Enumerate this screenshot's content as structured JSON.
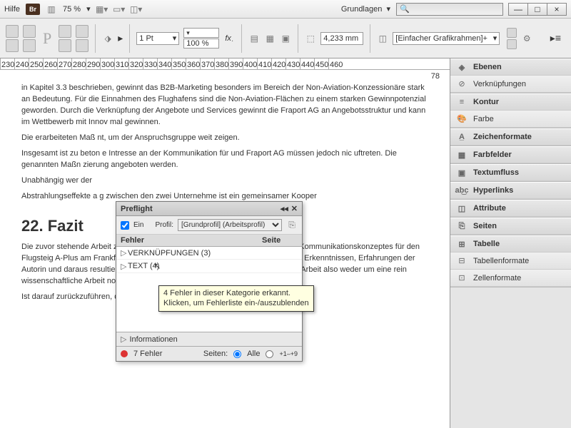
{
  "titlebar": {
    "help": "Hilfe",
    "bridge": "Br",
    "zoom": "75 %",
    "workspace": "Grundlagen",
    "search_placeholder": "🔍"
  },
  "toolbar": {
    "stroke": "1 Pt",
    "pct": "100 %",
    "measure": "4,233 mm",
    "frame": "[Einfacher Grafikrahmen]+"
  },
  "ruler": [
    "230",
    "240",
    "250",
    "260",
    "270",
    "280",
    "290",
    "300",
    "310",
    "320",
    "330",
    "340",
    "350",
    "360",
    "370",
    "380",
    "390",
    "400",
    "410",
    "420",
    "430",
    "440",
    "450",
    "460"
  ],
  "doc": {
    "pagenum": "78",
    "p1": "in Kapitel 3.3 beschrieben, gewinnt das B2B-Marketing besonders im Bereich der Non-Aviation-Konzessionäre stark an Bedeutung. Für die Einnahmen des Flughafens sind die Non-Aviation-Flächen zu einem starken Gewinnpotenzial geworden. Durch die Verknüpfung der Angebote und Services gewinnt die Fraport AG an Angebotsstruktur und kann im Wettbewerb mit Innov                                                                                         mal gewinnen.",
    "p2": "Die erarbeiteten Maß                                                                                       nt, um der Anspruchsgruppe weit                                                                                  zeigen.",
    "p3": "Insgesamt ist zu beton                                                                                     e Intresse an der Kommunikation für                                                                              und Fraport AG müssen jedoch nic                                                                                 uftreten. Die genannten Maßn                                                                                     zierung angeboten werden.",
    "p4": "Unabhängig wer der",
    "p5": "Abstrahlungseffekte a                                                                                      g zwischen den zwei Unternehme                                                                                    ist ein gemeinsamer Kooper",
    "h2": "22. Fazit",
    "p6": "Die zuvor stehende Arbeit zum Thema „Analyse zur Empfehlung eines digitalen Kommunikationskonzeptes für den Flugsteig A-Plus am Frankfurter Flughafen“ wurde aus literaturwissenschaftlicher Erkenntnissen, Erfahrungen der Autorin und daraus resultierenden Ergebnissen verfasst. Es handelt sich bei der Arbeit also weder um eine rein wissenschaftliche Arbeit noch um ein klassisches Kommunikationskonzept.",
    "p7": "Ist darauf zurückzuführen, dass es sich bei einem Flughafen um ein international"
  },
  "preflight": {
    "title": "Preflight",
    "on_label": "Ein",
    "profile_label": "Profil:",
    "profile_value": "[Grundprofil] (Arbeitsprofil)",
    "col_error": "Fehler",
    "col_page": "Seite",
    "items": [
      {
        "label": "VERKNÜPFUNGEN (3)"
      },
      {
        "label": "TEXT (4)"
      }
    ],
    "info": "Informationen",
    "err_count": "7 Fehler",
    "pages_label": "Seiten:",
    "pages_all": "Alle",
    "pages_range": "+1–+9"
  },
  "tooltip": {
    "line1": "4 Fehler in dieser Kategorie erkannt.",
    "line2": "Klicken, um Fehlerliste ein-/auszublenden"
  },
  "panels": [
    {
      "group": 1,
      "items": [
        {
          "icon": "◈",
          "label": "Ebenen"
        },
        {
          "icon": "⊘",
          "label": "Verknüpfungen"
        }
      ]
    },
    {
      "group": 2,
      "items": [
        {
          "icon": "≡",
          "label": "Kontur"
        },
        {
          "icon": "🎨",
          "label": "Farbe"
        }
      ]
    },
    {
      "group": 3,
      "items": [
        {
          "icon": "A̲",
          "label": "Zeichenformate"
        }
      ]
    },
    {
      "group": 4,
      "items": [
        {
          "icon": "▦",
          "label": "Farbfelder"
        }
      ]
    },
    {
      "group": 5,
      "items": [
        {
          "icon": "▣",
          "label": "Textumfluss"
        }
      ]
    },
    {
      "group": 6,
      "items": [
        {
          "icon": "ab͜c",
          "label": "Hyperlinks"
        }
      ]
    },
    {
      "group": 7,
      "items": [
        {
          "icon": "◫",
          "label": "Attribute"
        }
      ]
    },
    {
      "group": 8,
      "items": [
        {
          "icon": "⎘",
          "label": "Seiten"
        }
      ]
    },
    {
      "group": 9,
      "items": [
        {
          "icon": "⊞",
          "label": "Tabelle"
        },
        {
          "icon": "⊟",
          "label": "Tabellenformate"
        },
        {
          "icon": "⊡",
          "label": "Zellenformate"
        }
      ]
    }
  ]
}
